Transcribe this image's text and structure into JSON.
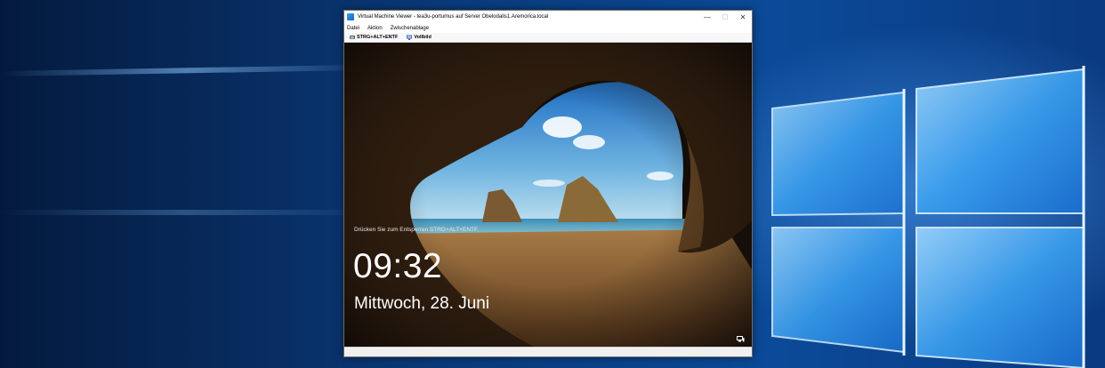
{
  "window": {
    "title": "Virtual Machine Viewer - tea3u-portumus auf Server Obelodalis1.Aremorica.local",
    "minimize_glyph": "—",
    "maximize_glyph": "☐",
    "close_glyph": "✕"
  },
  "menu": {
    "items": [
      "Datei",
      "Aktion",
      "Zwischenablage"
    ]
  },
  "toolbar": {
    "ctrl_alt_del_label": "STRG+ALT+ENTF",
    "fullscreen_label": "Vollbild"
  },
  "lockscreen": {
    "hint": "Drücken Sie zum Entsperren STRG+ALT+ENTF.",
    "time": "09:32",
    "date": "Mittwoch, 28. Juni"
  },
  "icons": {
    "app": "vm-viewer-icon",
    "ctrl_alt_del": "keyboard-icon",
    "fullscreen": "monitor-icon",
    "network": "network-icon"
  }
}
